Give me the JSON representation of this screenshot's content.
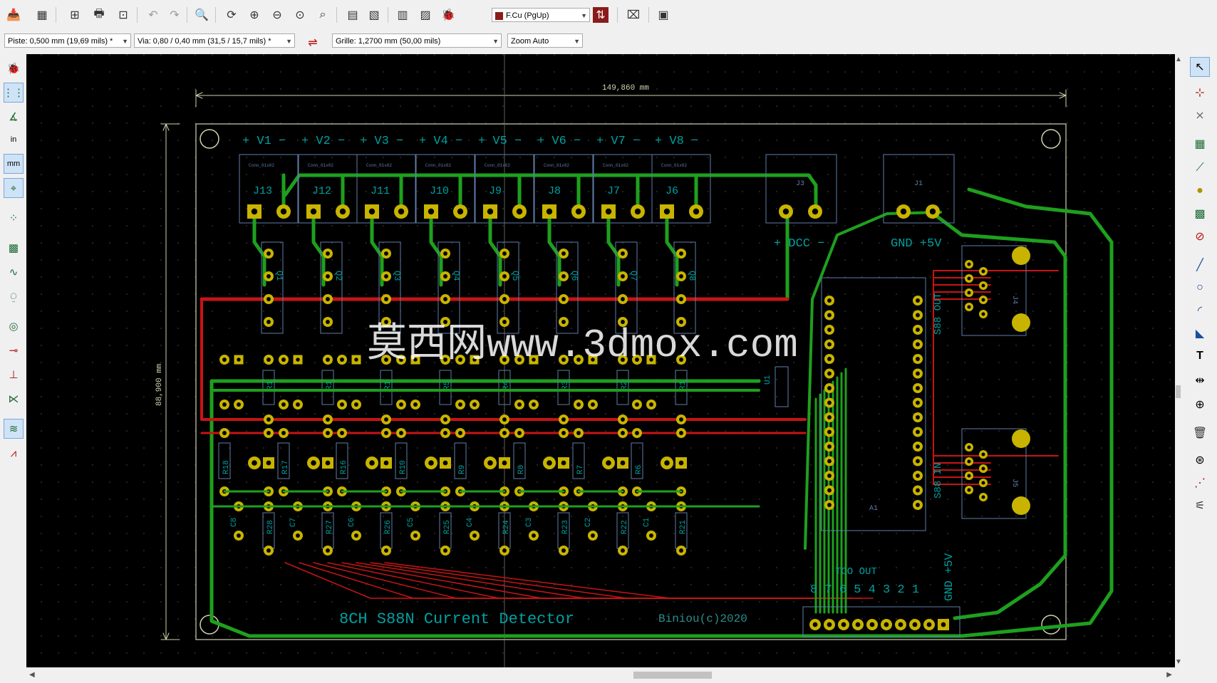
{
  "toolbar": {
    "layer_select": "F.Cu (PgUp)"
  },
  "options": {
    "track_width": "Piste: 0,500 mm (19,69 mils) *",
    "via_size": "Via: 0,80 / 0,40 mm (31,5 / 15,7 mils) *",
    "grid": "Grille: 1,2700 mm (50,00 mils)",
    "zoom": "Zoom Auto"
  },
  "board": {
    "dim_horizontal": "149,860 mm",
    "dim_vertical": "88,900 mm",
    "channel_labels": [
      "+ V1 −",
      "+ V2 −",
      "+ V3 −",
      "+ V4 −",
      "+ V5 −",
      "+ V6 −",
      "+ V7 −",
      "+ V8 −"
    ],
    "connector_refs": [
      "J13",
      "J12",
      "J11",
      "J10",
      "J9",
      "J8",
      "J7",
      "J6"
    ],
    "connector_value": "Conn_01x02",
    "dcc_label": "+ DCC −",
    "power_label": "GND +5V",
    "j3_ref": "J3",
    "j1_ref": "J1",
    "j4_ref": "J4",
    "j5_ref": "J5",
    "a1_ref": "A1",
    "u1_ref": "U1",
    "opto_refs": [
      "Q1",
      "Q2",
      "Q3",
      "Q4",
      "Q5",
      "Q6",
      "Q7",
      "Q8"
    ],
    "r_top_refs": [
      "R1",
      "R1",
      "R1",
      "R5",
      "R4",
      "R3",
      "R2",
      "R1"
    ],
    "r_mid_refs": [
      "R18",
      "R17",
      "R16",
      "R10",
      "R9",
      "R8",
      "R7",
      "R6"
    ],
    "c_refs": [
      "C8",
      "C7",
      "C6",
      "C5",
      "C4",
      "C3",
      "C2",
      "C1"
    ],
    "r_bot_refs": [
      "R28",
      "R27",
      "R26",
      "R25",
      "R24",
      "R23",
      "R22",
      "R21"
    ],
    "bottom_connector_label": "8 7 6 5 4 3 2 1",
    "bottom_connector_gnd": "GND +5V",
    "bottom_connector_title": "TCO OUT",
    "title_text": "8CH S88N Current Detector",
    "author_text": "Biniou(c)2020",
    "s88_label_1": "S88 OUT",
    "s88_label_2": "S88 IN",
    "watermark": "莫西网www.3dmox.com"
  },
  "colors": {
    "front_copper": "#c81414",
    "back_copper": "#1ea01e",
    "pad": "#c8b400",
    "silk": "#00a0a0",
    "edge": "#d0d0b0",
    "fab": "#5f7ea8"
  }
}
